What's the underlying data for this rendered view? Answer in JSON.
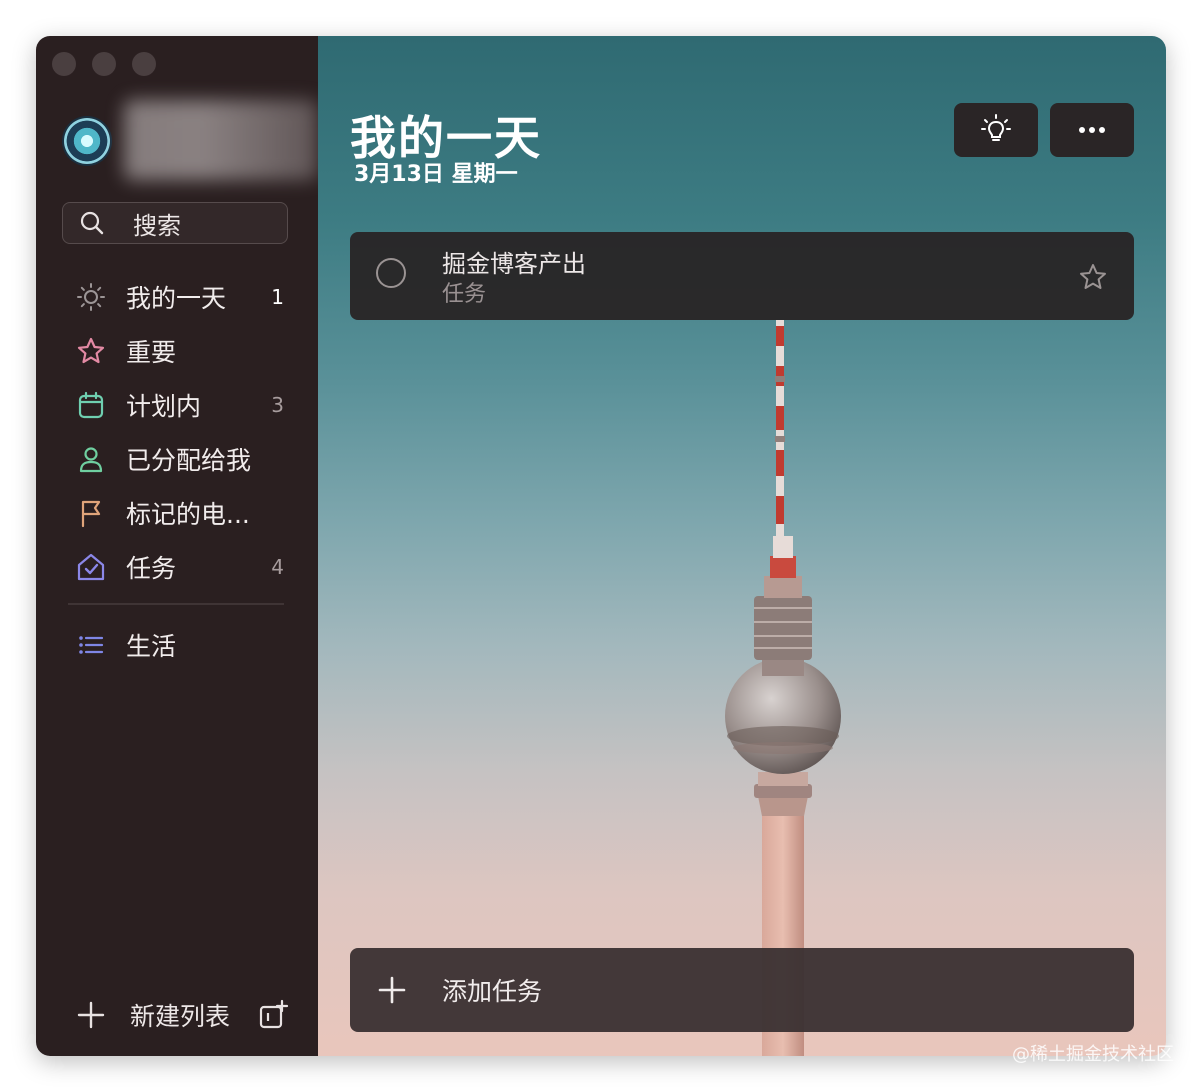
{
  "sidebar": {
    "search": {
      "label": "搜索",
      "icon": "search-icon"
    },
    "items": [
      {
        "label": "我的一天",
        "count": "1",
        "icon": "sun-icon",
        "color": "#9c9596"
      },
      {
        "label": "重要",
        "count": "",
        "icon": "star-icon",
        "color": "#e38aa4"
      },
      {
        "label": "计划内",
        "count": "3",
        "icon": "calendar-icon",
        "color": "#6fcfb0"
      },
      {
        "label": "已分配给我",
        "count": "",
        "icon": "person-icon",
        "color": "#6fcfa0"
      },
      {
        "label": "标记的电...",
        "count": "",
        "icon": "flag-icon",
        "color": "#e0a47a"
      },
      {
        "label": "任务",
        "count": "4",
        "icon": "home-icon",
        "color": "#8b87e8"
      }
    ],
    "lists": [
      {
        "label": "生活",
        "icon": "list-icon",
        "color": "#7f86e6"
      }
    ],
    "new_list": {
      "label": "新建列表",
      "icon": "plus-icon",
      "group_icon": "new-group-icon"
    }
  },
  "main": {
    "title": "我的一天",
    "date": "3月13日 星期一",
    "buttons": {
      "suggest_icon": "lightbulb-icon",
      "more_icon": "more-icon"
    },
    "tasks": [
      {
        "name": "掘金博客产出",
        "list": "任务",
        "important": false
      }
    ],
    "add_task": {
      "label": "添加任务",
      "icon": "plus-icon"
    },
    "watermark": "@稀土掘金技术社区"
  }
}
